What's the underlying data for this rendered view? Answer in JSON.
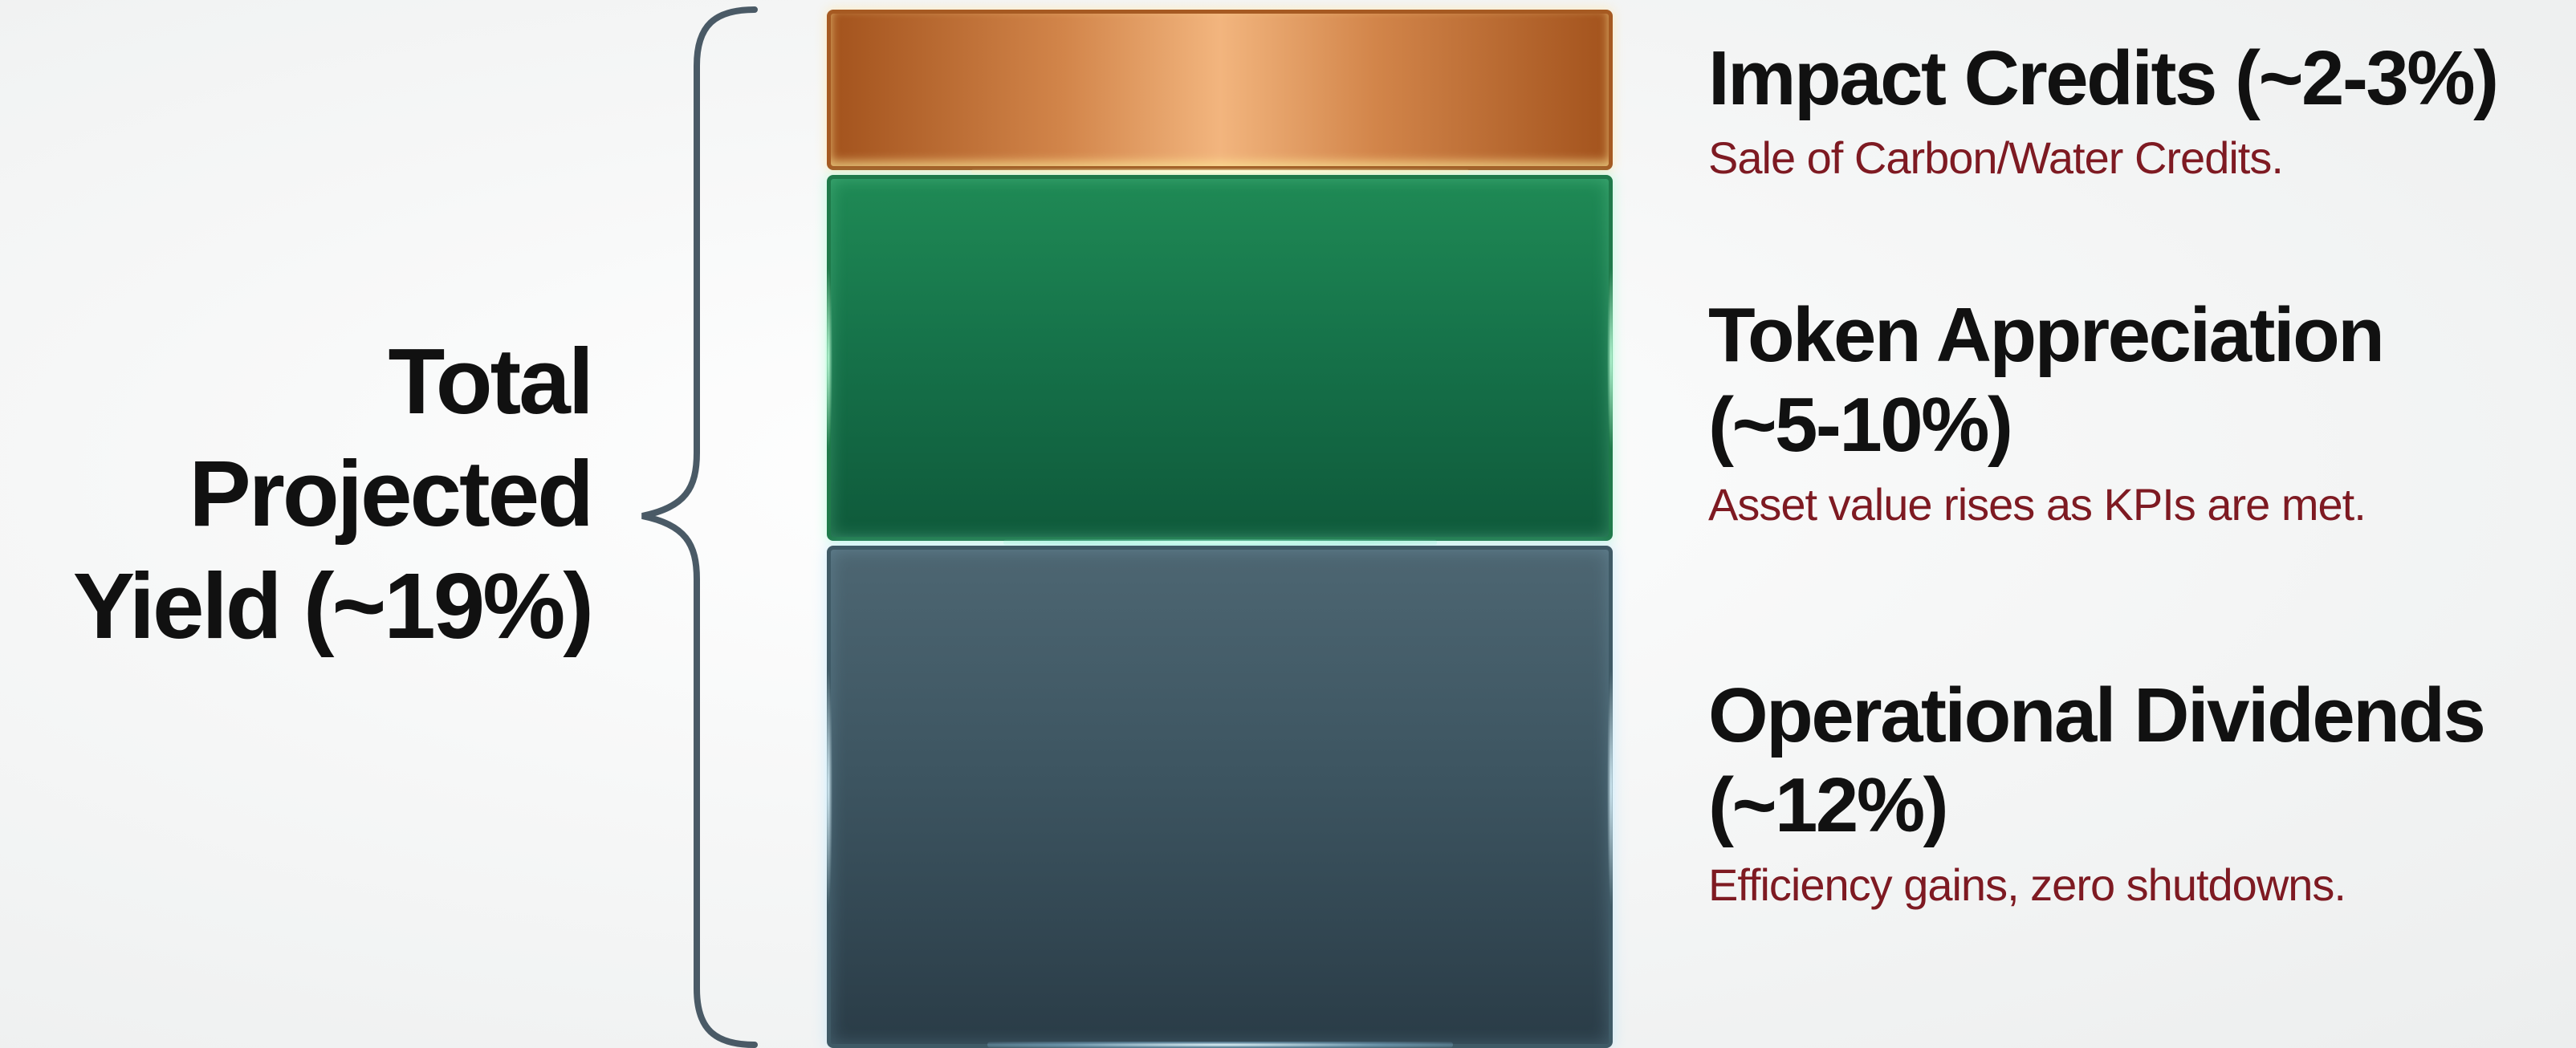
{
  "total": {
    "lines": [
      "Total",
      "Projected",
      "Yield (~19%)"
    ]
  },
  "segments": [
    {
      "id": "impact",
      "title": "Impact Credits (~2-3%)",
      "title_lines": [
        "Impact Credits (~2-3%)"
      ],
      "description": "Sale of Carbon/Water Credits.",
      "color": "#c8783e"
    },
    {
      "id": "token",
      "title": "Token Appreciation (~5-10%)",
      "title_lines": [
        "Token Appreciation",
        "(~5-10%)"
      ],
      "description": "Asset value rises as KPIs are met.",
      "color": "#177a4c"
    },
    {
      "id": "ops",
      "title": "Operational Dividends (~12%)",
      "title_lines": [
        "Operational Dividends",
        "(~12%)"
      ],
      "description": "Efficiency gains, zero shutdowns.",
      "color": "#3c5360"
    }
  ],
  "colors": {
    "label_text": "#111111",
    "description_text": "#7e1a22",
    "brace": "#4a5a66"
  }
}
